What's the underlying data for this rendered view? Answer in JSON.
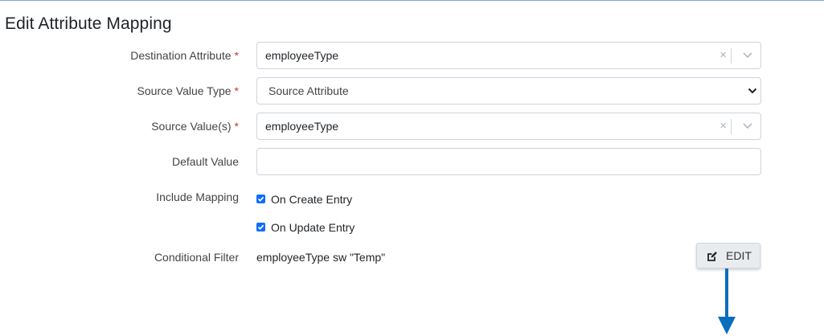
{
  "page": {
    "title": "Edit Attribute Mapping"
  },
  "colors": {
    "accent": "#0d6efd",
    "required": "#d0342c",
    "arrow": "#0a6ebd"
  },
  "fields": {
    "destination_attribute": {
      "label": "Destination Attribute",
      "required_mark": "*",
      "value": "employeeType"
    },
    "source_value_type": {
      "label": "Source Value Type",
      "required_mark": "*",
      "value": "Source Attribute"
    },
    "source_values": {
      "label": "Source Value(s)",
      "required_mark": "*",
      "value": "employeeType"
    },
    "default_value": {
      "label": "Default Value",
      "value": ""
    },
    "include_mapping": {
      "label": "Include Mapping",
      "options": [
        {
          "label": "On Create Entry",
          "checked": true
        },
        {
          "label": "On Update Entry",
          "checked": true
        }
      ]
    },
    "conditional_filter": {
      "label": "Conditional Filter",
      "value": "employeeType sw \"Temp\""
    }
  },
  "icons": {
    "clear": "×",
    "dropdown": "chevron-down-icon",
    "edit": "edit-icon"
  },
  "buttons": {
    "edit_label": "EDIT"
  }
}
